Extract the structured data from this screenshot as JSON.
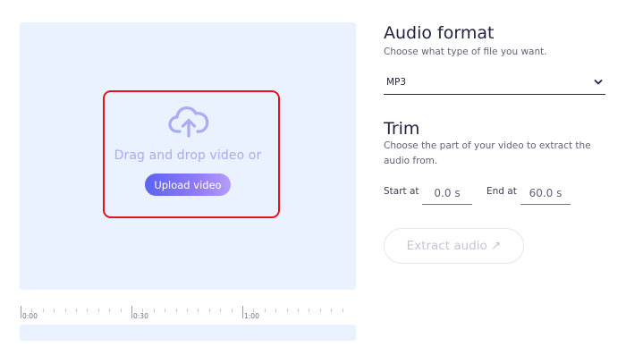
{
  "upload": {
    "drop_text": "Drag and drop video or",
    "button_label": "Upload video",
    "icon": "cloud-upload-icon"
  },
  "timeline": {
    "labels": [
      "0:00",
      "0:30",
      "1:00"
    ]
  },
  "audio_format": {
    "title": "Audio format",
    "description": "Choose what type of file you want.",
    "selected": "MP3"
  },
  "trim": {
    "title": "Trim",
    "description": "Choose the part of your video to extract the audio from.",
    "start_label": "Start at",
    "start_value": "0.0 s",
    "end_label": "End at",
    "end_value": "60.0 s"
  },
  "extract": {
    "label": "Extract audio ↗"
  },
  "colors": {
    "highlight": "#e5121c",
    "accent": "#5b63f0",
    "dropzone_bg": "#ebf2ff"
  }
}
